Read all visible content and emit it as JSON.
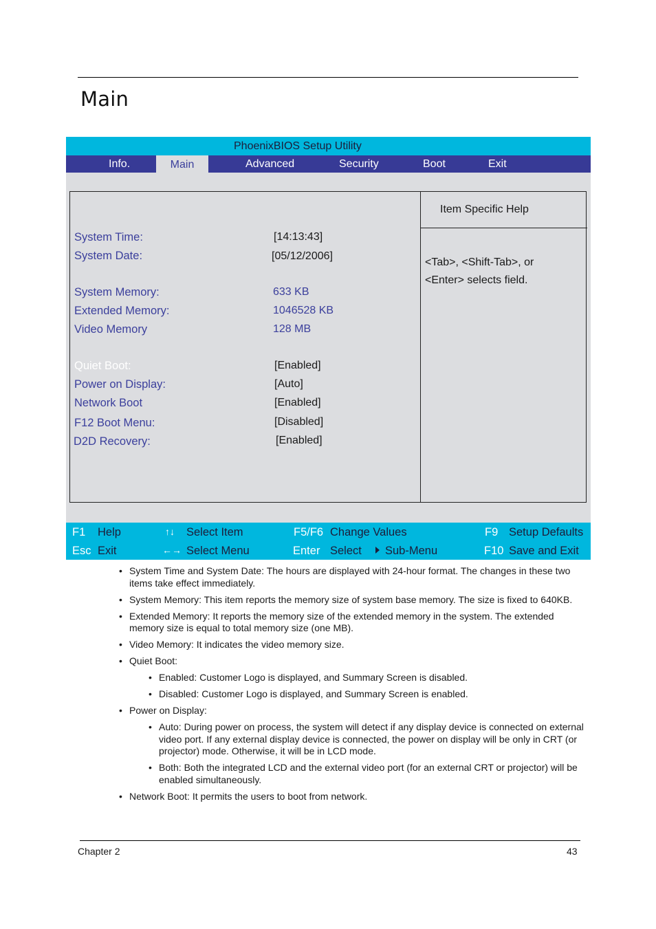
{
  "page": {
    "title": "Main",
    "footer": {
      "chapter": "Chapter 2",
      "page_number": "43"
    }
  },
  "bios": {
    "title": "PhoenixBIOS Setup Utility",
    "menu": [
      {
        "label": "Info.",
        "active": false
      },
      {
        "label": "Main",
        "active": true
      },
      {
        "label": "Advanced",
        "active": false
      },
      {
        "label": "Security",
        "active": false
      },
      {
        "label": "Boot",
        "active": false
      },
      {
        "label": "Exit",
        "active": false
      }
    ],
    "fields": [
      {
        "label": "System Time:",
        "value": "[14:13:43]"
      },
      {
        "label": "System Date:",
        "value": "[05/12/2006]"
      },
      {
        "label": "System Memory:",
        "value": "633 KB"
      },
      {
        "label": "Extended Memory:",
        "value": "1046528 KB"
      },
      {
        "label": "Video Memory",
        "value": "128 MB"
      },
      {
        "label": "Quiet Boot:",
        "value": "[Enabled]",
        "selected": true
      },
      {
        "label": "Power on Display:",
        "value": "[Auto]"
      },
      {
        "label": "Network Boot",
        "value": "[Enabled]"
      },
      {
        "label": "F12 Boot Menu:",
        "value": "[Disabled]"
      },
      {
        "label": "D2D Recovery:",
        "value": "[Enabled]"
      }
    ],
    "help": {
      "title": "Item Specific Help",
      "line1": "<Tab>, <Shift-Tab>, or",
      "line2": "<Enter> selects field."
    },
    "keys": [
      {
        "key": "F1",
        "desc": "Help"
      },
      {
        "key": "Esc",
        "desc": "Exit"
      },
      {
        "key": "↑↓",
        "desc": "Select Item"
      },
      {
        "key": "←→",
        "desc": "Select Menu"
      },
      {
        "key": "F5/F6",
        "desc": "Change Values"
      },
      {
        "key": "Enter",
        "desc": "Select",
        "extra": "Sub-Menu"
      },
      {
        "key": "F9",
        "desc": "Setup Defaults"
      },
      {
        "key": "F10",
        "desc": "Save and Exit"
      }
    ],
    "colors": {
      "title_bar": "#00b7de",
      "menu_bar": "#373a96",
      "panel_bg": "#dcdde0",
      "label_blue": "#3b3f9c"
    }
  },
  "notes": [
    "System Time and System Date: The hours are displayed with 24-hour format. The changes in these two items take effect immediately.",
    "System Memory: This item reports the memory size of system base memory. The size is fixed to 640KB.",
    "Extended Memory: It reports the memory size of the extended memory in the system. The extended memory size is equal to total memory size (one MB).",
    "Video Memory: It indicates the video memory size.",
    "Quiet Boot:",
    "Enabled: Customer Logo is displayed, and Summary Screen is disabled.",
    "Disabled: Customer Logo is displayed, and Summary Screen is enabled.",
    "Power on Display:",
    "Auto: During power on process, the system will detect if any display device is connected on external video port. If any external display device is connected, the power on display will be only in CRT (or projector) mode. Otherwise, it will be in LCD mode.",
    "Both: Both the integrated LCD and the external video port (for an external CRT or projector) will be enabled simultaneously.",
    "Network Boot: It permits the users to boot from network."
  ]
}
